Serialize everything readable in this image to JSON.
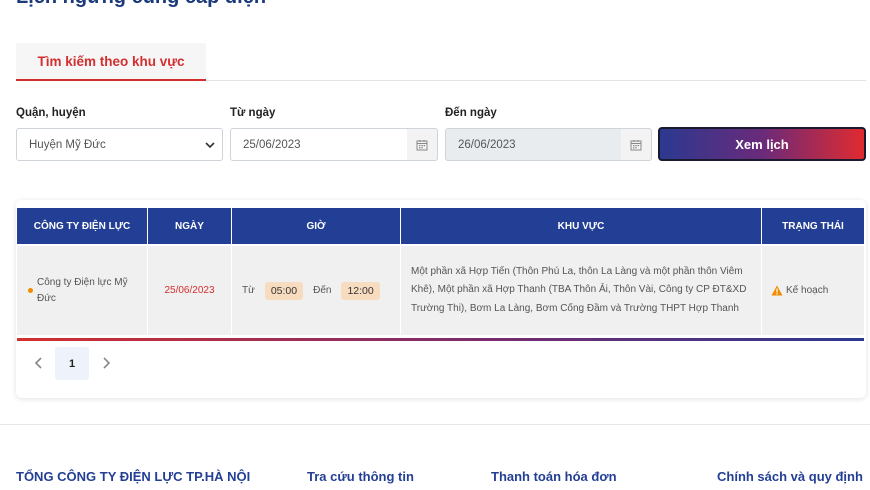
{
  "header": {
    "partial_title": "Lịch ngừng cung cấp điện"
  },
  "tabs": [
    {
      "label": "Tìm kiếm theo khu vực",
      "active": true
    }
  ],
  "filters": {
    "district_label": "Quận, huyện",
    "district_value": "Huyện Mỹ Đức",
    "from_label": "Từ ngày",
    "from_value": "25/06/2023",
    "to_label": "Đến ngày",
    "to_value": "26/06/2023",
    "submit_label": "Xem lịch"
  },
  "table": {
    "headers": [
      "CÔNG TY ĐIỆN LỰC",
      "NGÀY",
      "GIỜ",
      "KHU VỰC",
      "TRẠNG THÁI"
    ],
    "rows": [
      {
        "company": "Công ty Điện lực Mỹ Đức",
        "date": "25/06/2023",
        "time_from_label": "Từ",
        "time_from": "05:00",
        "time_to_label": "Đến",
        "time_to": "12:00",
        "area": "Một phần xã Hợp Tiến (Thôn Phú La, thôn La Làng và một phần thôn Viêm Khê), Một phần xã Hợp Thanh (TBA Thôn Ải, Thôn Vài, Công ty CP ĐT&XD Trường Thi), Bơm La Làng, Bơm Cống Đầm và Trường THPT Hợp Thanh",
        "status": "Kế hoạch"
      }
    ]
  },
  "pagination": {
    "current_page": "1"
  },
  "footer": {
    "links": [
      "TỔNG CÔNG TY ĐIỆN LỰC TP.HÀ NỘI",
      "Tra cứu thông tin",
      "Thanh toán hóa đơn",
      "Chính sách và quy định"
    ]
  },
  "colors": {
    "brand_blue": "#233f95",
    "brand_red": "#d32f2f",
    "time_chip": "#f8dcc0",
    "status_warning": "#f08c00"
  }
}
